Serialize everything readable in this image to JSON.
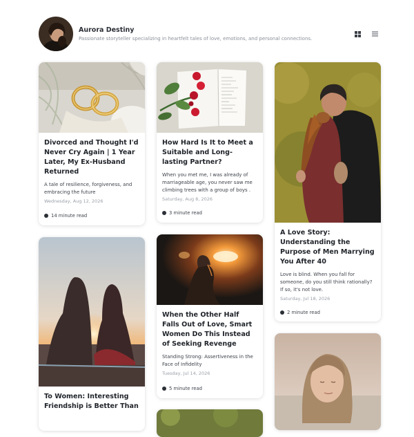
{
  "author": {
    "name": "Aurora Destiny",
    "bio": "Passionate storyteller specializing in heartfelt tales of love, emotions, and personal connections."
  },
  "view_toggle": {
    "grid_icon": "grid-view-icon",
    "list_icon": "list-view-icon"
  },
  "posts": [
    {
      "title": "Divorced and Thought I'd Never Cry Again | 1 Year Later, My Ex-Husband Returned",
      "excerpt": "A tale of resilience, forgiveness, and embracing the future",
      "date": "Wednesday, Aug 12, 2026",
      "read_time": "14 minute read"
    },
    {
      "title": "How Hard Is It to Meet a Suitable and Long-lasting Partner?",
      "excerpt": "When you met me, I was already of marriageable age, you never saw me climbing trees with a group of boys .",
      "date": "Saturday, Aug 8, 2026",
      "read_time": "3 minute read"
    },
    {
      "title": "A Love Story: Understanding the Purpose of Men Marrying You After 40",
      "excerpt": "Love is blind. When you fall for someone, do you still think rationally? If so, it's not love.",
      "date": "Saturday, Jul 18, 2026",
      "read_time": "2 minute read"
    },
    {
      "title": "To Women: Interesting Friendship is Better Than"
    },
    {
      "title": "When the Other Half Falls Out of Love, Smart Women Do This Instead of Seeking Revenge",
      "excerpt": "Standing Strong: Assertiveness in the Face of Infidelity",
      "date": "Tuesday, Jul 14, 2026",
      "read_time": "5 minute read"
    }
  ]
}
